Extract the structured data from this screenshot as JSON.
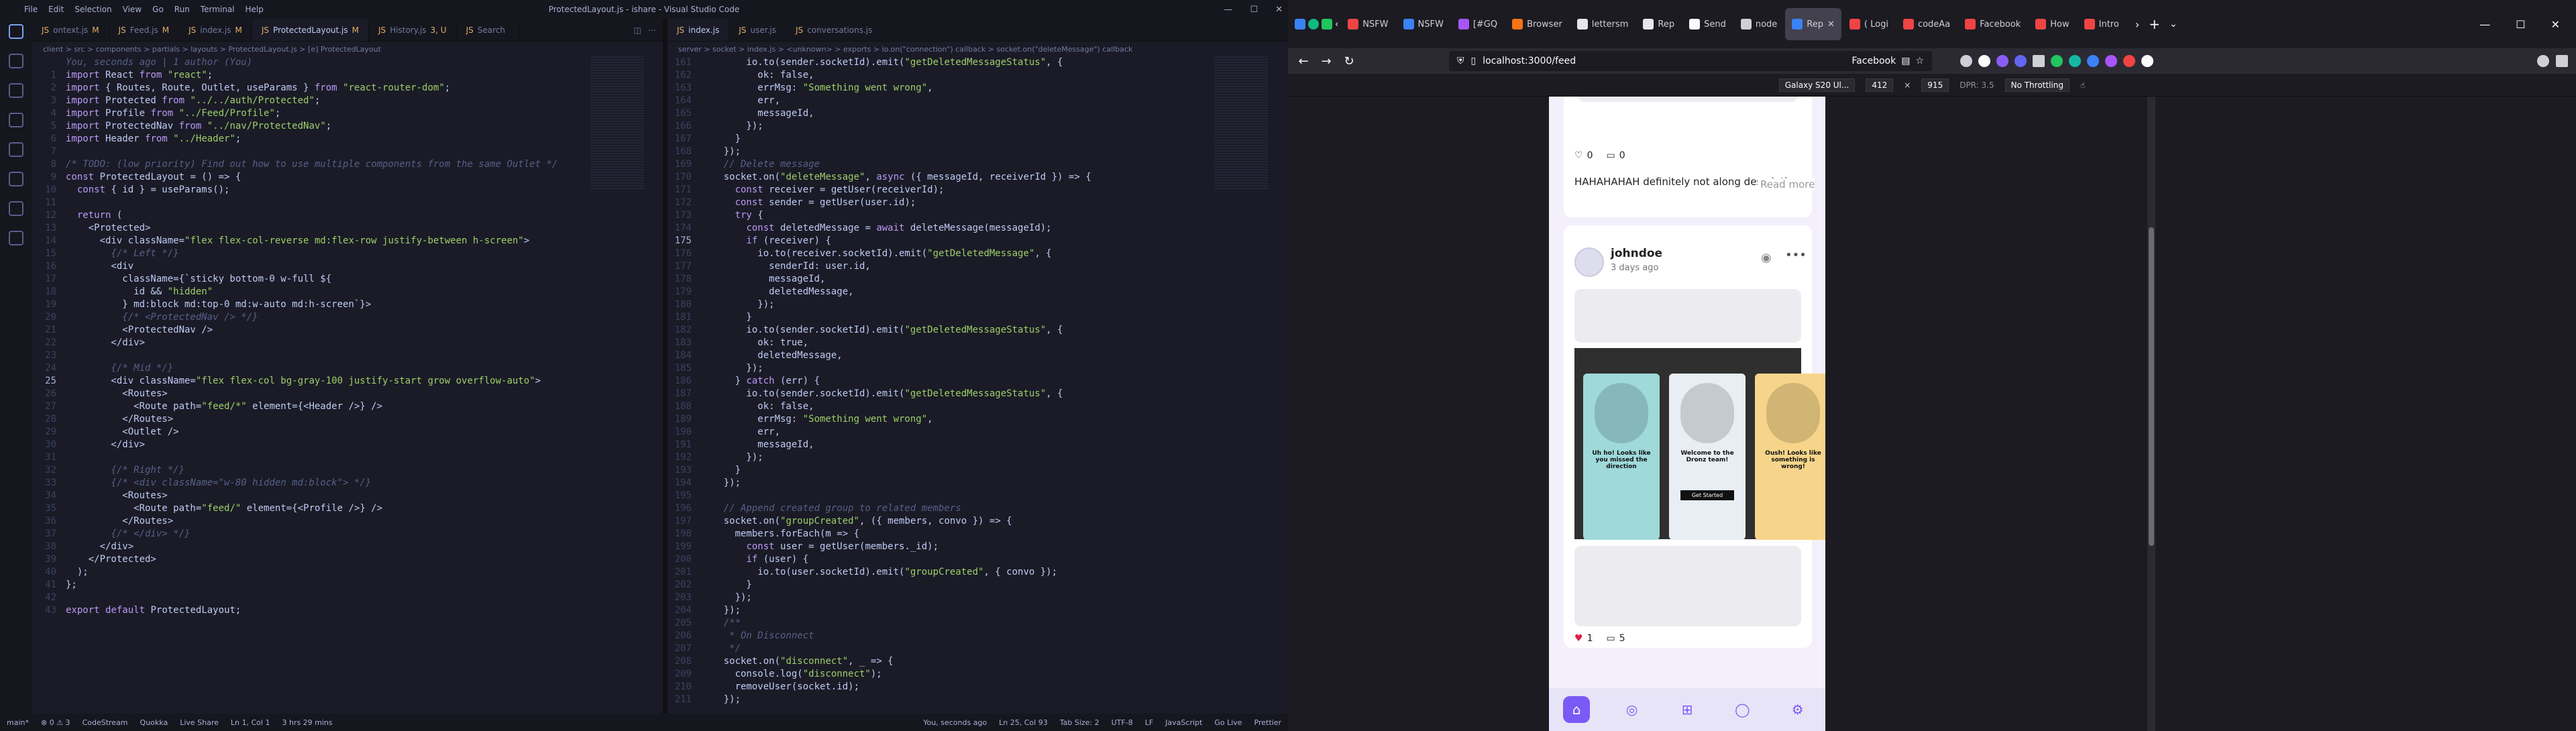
{
  "vscode": {
    "menu": [
      "File",
      "Edit",
      "Selection",
      "View",
      "Go",
      "Run",
      "Terminal",
      "Help"
    ],
    "title": "ProtectedLayout.js - ishare - Visual Studio Code",
    "left_tabs": [
      "ontext.js",
      "Feed.js",
      "index.js",
      "ProtectedLayout.js",
      "History.js",
      "Search"
    ],
    "left_tab_badges": [
      "M",
      "M",
      "M",
      "M",
      "3, U",
      ""
    ],
    "right_tabs": [
      "index.js",
      "user.js",
      "conversations.js"
    ],
    "left_crumb": "client > src > components > partials > layouts > ProtectedLayout.js > [e] ProtectedLayout",
    "right_crumb": "server > socket > index.js > <unknown> > exports > io.on(\"connection\") callback > socket.on(\"deleteMessage\") callback",
    "left_code": [
      {
        "n": "",
        "t": "You, seconds ago | 1 author (You)"
      },
      {
        "n": "1",
        "t": "import React from \"react\";"
      },
      {
        "n": "2",
        "t": "import { Routes, Route, Outlet, useParams } from \"react-router-dom\";"
      },
      {
        "n": "3",
        "t": "import Protected from \"../../auth/Protected\";"
      },
      {
        "n": "4",
        "t": "import Profile from \"../Feed/Profile\";"
      },
      {
        "n": "5",
        "t": "import ProtectedNav from \"../nav/ProtectedNav\";"
      },
      {
        "n": "6",
        "t": "import Header from \"../Header\";"
      },
      {
        "n": "7",
        "t": ""
      },
      {
        "n": "8",
        "t": "/* TODO: (low priority) Find out how to use multiple components from the same Outlet */"
      },
      {
        "n": "9",
        "t": "const ProtectedLayout = () => {"
      },
      {
        "n": "10",
        "t": "  const { id } = useParams();"
      },
      {
        "n": "11",
        "t": ""
      },
      {
        "n": "12",
        "t": "  return ("
      },
      {
        "n": "13",
        "t": "    <Protected>"
      },
      {
        "n": "14",
        "t": "      <div className=\"flex flex-col-reverse md:flex-row justify-between h-screen\">"
      },
      {
        "n": "15",
        "t": "        {/* Left */}"
      },
      {
        "n": "16",
        "t": "        <div"
      },
      {
        "n": "17",
        "t": "          className={`sticky bottom-0 w-full ${"
      },
      {
        "n": "18",
        "t": "            id && \"hidden\""
      },
      {
        "n": "19",
        "t": "          } md:block md:top-0 md:w-auto md:h-screen`}>"
      },
      {
        "n": "20",
        "t": "          {/* <ProtectedNav /> */}"
      },
      {
        "n": "21",
        "t": "          <ProtectedNav />"
      },
      {
        "n": "22",
        "t": "        </div>"
      },
      {
        "n": "23",
        "t": ""
      },
      {
        "n": "24",
        "t": "        {/* Mid */}"
      },
      {
        "n": "25",
        "t": "        <div className=\"flex flex-col bg-gray-100 justify-start grow overflow-auto\">"
      },
      {
        "n": "26",
        "t": "          <Routes>"
      },
      {
        "n": "27",
        "t": "            <Route path=\"feed/*\" element={<Header />} />"
      },
      {
        "n": "28",
        "t": "          </Routes>"
      },
      {
        "n": "29",
        "t": "          <Outlet />"
      },
      {
        "n": "30",
        "t": "        </div>"
      },
      {
        "n": "31",
        "t": ""
      },
      {
        "n": "32",
        "t": "        {/* Right */}"
      },
      {
        "n": "33",
        "t": "        {/* <div className=\"w-80 hidden md:block\"> */}"
      },
      {
        "n": "34",
        "t": "          <Routes>"
      },
      {
        "n": "35",
        "t": "            <Route path=\"feed/\" element={<Profile />} />"
      },
      {
        "n": "36",
        "t": "          </Routes>"
      },
      {
        "n": "37",
        "t": "        {/* </div> */}"
      },
      {
        "n": "38",
        "t": "      </div>"
      },
      {
        "n": "39",
        "t": "    </Protected>"
      },
      {
        "n": "40",
        "t": "  );"
      },
      {
        "n": "41",
        "t": "};"
      },
      {
        "n": "42",
        "t": ""
      },
      {
        "n": "43",
        "t": "export default ProtectedLayout;"
      }
    ],
    "right_code": [
      {
        "n": "161",
        "t": "        io.to(sender.socketId).emit(\"getDeletedMessageStatus\", {"
      },
      {
        "n": "162",
        "t": "          ok: false,"
      },
      {
        "n": "163",
        "t": "          errMsg: \"Something went wrong\","
      },
      {
        "n": "164",
        "t": "          err,"
      },
      {
        "n": "165",
        "t": "          messageId,"
      },
      {
        "n": "166",
        "t": "        });"
      },
      {
        "n": "167",
        "t": "      }"
      },
      {
        "n": "168",
        "t": "    });"
      },
      {
        "n": "169",
        "t": "    // Delete message"
      },
      {
        "n": "170",
        "t": "    socket.on(\"deleteMessage\", async ({ messageId, receiverId }) => {"
      },
      {
        "n": "171",
        "t": "      const receiver = getUser(receiverId);"
      },
      {
        "n": "172",
        "t": "      const sender = getUser(user.id);"
      },
      {
        "n": "173",
        "t": "      try {"
      },
      {
        "n": "174",
        "t": "        const deletedMessage = await deleteMessage(messageId);"
      },
      {
        "n": "175",
        "t": "        if (receiver) {"
      },
      {
        "n": "176",
        "t": "          io.to(receiver.socketId).emit(\"getDeletedMessage\", {"
      },
      {
        "n": "177",
        "t": "            senderId: user.id,"
      },
      {
        "n": "178",
        "t": "            messageId,"
      },
      {
        "n": "179",
        "t": "            deletedMessage,"
      },
      {
        "n": "180",
        "t": "          });"
      },
      {
        "n": "181",
        "t": "        }"
      },
      {
        "n": "182",
        "t": "        io.to(sender.socketId).emit(\"getDeletedMessageStatus\", {"
      },
      {
        "n": "183",
        "t": "          ok: true,"
      },
      {
        "n": "184",
        "t": "          deletedMessage,"
      },
      {
        "n": "185",
        "t": "        });"
      },
      {
        "n": "186",
        "t": "      } catch (err) {"
      },
      {
        "n": "187",
        "t": "        io.to(sender.socketId).emit(\"getDeletedMessageStatus\", {"
      },
      {
        "n": "188",
        "t": "          ok: false,"
      },
      {
        "n": "189",
        "t": "          errMsg: \"Something went wrong\","
      },
      {
        "n": "190",
        "t": "          err,"
      },
      {
        "n": "191",
        "t": "          messageId,"
      },
      {
        "n": "192",
        "t": "        });"
      },
      {
        "n": "193",
        "t": "      }"
      },
      {
        "n": "194",
        "t": "    });"
      },
      {
        "n": "195",
        "t": ""
      },
      {
        "n": "196",
        "t": "    // Append created group to related members"
      },
      {
        "n": "197",
        "t": "    socket.on(\"groupCreated\", ({ members, convo }) => {"
      },
      {
        "n": "198",
        "t": "      members.forEach(m => {"
      },
      {
        "n": "199",
        "t": "        const user = getUser(members._id);"
      },
      {
        "n": "200",
        "t": "        if (user) {"
      },
      {
        "n": "201",
        "t": "          io.to(user.socketId).emit(\"groupCreated\", { convo });"
      },
      {
        "n": "202",
        "t": "        }"
      },
      {
        "n": "203",
        "t": "      });"
      },
      {
        "n": "204",
        "t": "    });"
      },
      {
        "n": "205",
        "t": "    /**"
      },
      {
        "n": "206",
        "t": "     * On Disconnect"
      },
      {
        "n": "207",
        "t": "     */"
      },
      {
        "n": "208",
        "t": "    socket.on(\"disconnect\", _ => {"
      },
      {
        "n": "209",
        "t": "      console.log(\"disconnect\");"
      },
      {
        "n": "210",
        "t": "      removeUser(socket.id);"
      },
      {
        "n": "211",
        "t": "    });"
      }
    ],
    "status_left": [
      "main*",
      "⊗ 0 ⚠ 3",
      "CodeStream",
      "Quokka",
      "Live Share",
      "Ln 1, Col 1",
      "3 hrs 29 mins"
    ],
    "status_right": [
      "You, seconds ago",
      "Ln 25, Col 93",
      "Tab Size: 2",
      "UTF-8",
      "LF",
      "JavaScript",
      "Go Live",
      "Prettier"
    ]
  },
  "firefox": {
    "tabs": [
      "NSFW",
      "NSFW",
      "[#GQ",
      "Browser",
      "lettersm",
      "Rep",
      "Send",
      "node",
      "Rep",
      "( Logi",
      "codeAa",
      "Facebook",
      "How",
      "Intro"
    ],
    "active_tab_index": 8,
    "url": "localhost:3000/feed",
    "bookmark_label": "Facebook",
    "rdm": {
      "device": "Galaxy S20 Ul...",
      "width": "412",
      "height": "915",
      "dpr": "DPR: 3.5",
      "throttle": "No Throttling"
    },
    "post1": {
      "likes": "0",
      "comments": "0",
      "description": "HAHAHAHAH definitely not along description cause i want to test c",
      "read_more": "Read more"
    },
    "post2": {
      "username": "johndoe",
      "date": "3 days ago",
      "likes": "1",
      "comments": "5",
      "phones": [
        {
          "title": "Uh ho! Looks like you missed the direction",
          "color": "#9fd9da"
        },
        {
          "title": "Welcome to the Dronz team!",
          "color": "#e8eef3"
        },
        {
          "title": "Oush! Looks like something is wrong!",
          "color": "#f6d58a"
        }
      ],
      "phone_button": "Get Started"
    },
    "bottom_nav": [
      "home-icon",
      "explore-icon",
      "add-icon",
      "profile-icon",
      "settings-icon"
    ]
  }
}
